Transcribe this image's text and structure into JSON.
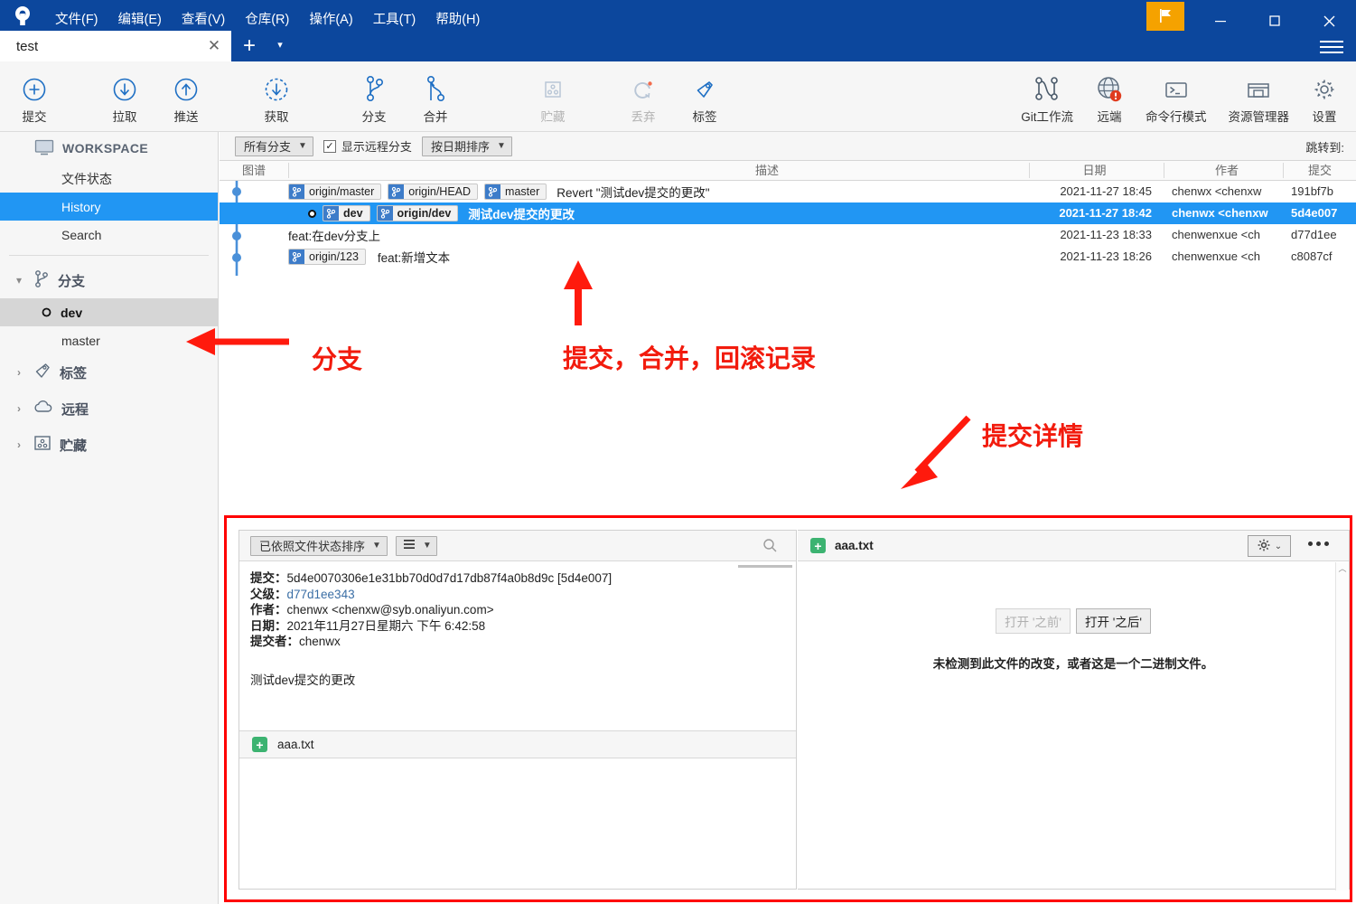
{
  "app": {
    "logo_icon": "sourcetree-logo-icon",
    "menu": [
      {
        "label": "文件(F)",
        "accel": "F"
      },
      {
        "label": "编辑(E)",
        "accel": "E"
      },
      {
        "label": "查看(V)",
        "accel": "V"
      },
      {
        "label": "仓库(R)",
        "accel": "R"
      },
      {
        "label": "操作(A)",
        "accel": "A"
      },
      {
        "label": "工具(T)",
        "accel": "T"
      },
      {
        "label": "帮助(H)",
        "accel": "H"
      }
    ],
    "window_controls": {
      "flag_icon": "flag-icon",
      "minimize": "—",
      "maximize": "☐",
      "close": "✕",
      "menu_icon": "hamburger-icon"
    }
  },
  "tabs": {
    "items": [
      {
        "label": "test",
        "close_icon": "close-icon"
      }
    ],
    "add_label": "+",
    "caret_label": "▾"
  },
  "toolbar": {
    "left_buttons": [
      {
        "label": "提交",
        "icon": "commit-plus-icon",
        "disabled": false
      },
      {
        "label": "拉取",
        "icon": "pull-down-arrow-icon",
        "disabled": false
      },
      {
        "label": "推送",
        "icon": "push-up-arrow-icon",
        "disabled": false
      },
      {
        "label": "获取",
        "icon": "fetch-dashed-arrow-icon",
        "disabled": false
      },
      {
        "label": "分支",
        "icon": "branch-icon",
        "disabled": false
      },
      {
        "label": "合并",
        "icon": "merge-icon",
        "disabled": false
      },
      {
        "label": "贮藏",
        "icon": "stash-icon",
        "disabled": true
      },
      {
        "label": "丢弃",
        "icon": "discard-revert-icon",
        "disabled": true
      },
      {
        "label": "标签",
        "icon": "tag-icon",
        "disabled": false
      }
    ],
    "right_buttons": [
      {
        "label": "Git工作流",
        "icon": "gitflow-icon",
        "badge": false
      },
      {
        "label": "远端",
        "icon": "globe-remote-icon",
        "badge": true
      },
      {
        "label": "命令行模式",
        "icon": "terminal-icon",
        "badge": false
      },
      {
        "label": "资源管理器",
        "icon": "explorer-folder-icon",
        "badge": false
      },
      {
        "label": "设置",
        "icon": "gear-icon",
        "badge": false
      }
    ]
  },
  "sidebar": {
    "workspace": {
      "label": "WORKSPACE",
      "icon": "monitor-icon"
    },
    "views": [
      {
        "label": "文件状态",
        "selected": false
      },
      {
        "label": "History",
        "selected": true
      },
      {
        "label": "Search",
        "selected": false
      }
    ],
    "groups": [
      {
        "label": "分支",
        "icon": "branch-icon",
        "expanded": true,
        "chevron": "▾",
        "items": [
          {
            "label": "dev",
            "active": true,
            "icon": "current-branch-dot-icon"
          },
          {
            "label": "master",
            "active": false,
            "icon": ""
          }
        ]
      },
      {
        "label": "标签",
        "icon": "tag-icon",
        "expanded": false,
        "chevron": "›",
        "items": []
      },
      {
        "label": "远程",
        "icon": "cloud-icon",
        "expanded": false,
        "chevron": "›",
        "items": []
      },
      {
        "label": "贮藏",
        "icon": "stash-icon",
        "expanded": false,
        "chevron": "›",
        "items": []
      }
    ]
  },
  "history": {
    "filter_branch": "所有分支",
    "show_remote_label": "显示远程分支",
    "show_remote_checked": true,
    "sort_label": "按日期排序",
    "jump_to_label": "跳转到:",
    "columns": [
      {
        "key": "graph",
        "label": "图谱"
      },
      {
        "key": "description",
        "label": "描述"
      },
      {
        "key": "date",
        "label": "日期"
      },
      {
        "key": "author",
        "label": "作者"
      },
      {
        "key": "commit",
        "label": "提交"
      }
    ],
    "rows": [
      {
        "refs": [
          {
            "name": "origin/master",
            "type": "remote"
          },
          {
            "name": "origin/HEAD",
            "type": "remote"
          },
          {
            "name": "master",
            "type": "local"
          }
        ],
        "head": false,
        "description": "Revert \"测试dev提交的更改\"",
        "date": "2021-11-27 18:45",
        "author": "chenwx <chenxw",
        "commit": "191bf7b",
        "selected": false
      },
      {
        "refs": [
          {
            "name": "dev",
            "type": "local"
          },
          {
            "name": "origin/dev",
            "type": "remote"
          }
        ],
        "head": true,
        "description": "测试dev提交的更改",
        "date": "2021-11-27 18:42",
        "author": "chenwx <chenxw",
        "commit": "5d4e007",
        "selected": true
      },
      {
        "refs": [],
        "head": false,
        "description": "feat:在dev分支上",
        "date": "2021-11-23 18:33",
        "author": "chenwenxue <ch",
        "commit": "d77d1ee",
        "selected": false
      },
      {
        "refs": [
          {
            "name": "origin/123",
            "type": "remote"
          }
        ],
        "head": false,
        "description": "feat:新增文本",
        "date": "2021-11-23 18:26",
        "author": "chenwenxue <ch",
        "commit": "c8087cf",
        "selected": false
      }
    ]
  },
  "detail": {
    "left": {
      "sort_combo": "已依照文件状态排序",
      "list_mode_icon": "list-view-icon",
      "search_icon": "search-icon",
      "meta": {
        "commit_key": "提交：",
        "commit_value": "5d4e0070306e1e31bb70d0d7d17db87f4a0b8d9c [5d4e007]",
        "parent_key": "父级：",
        "parent_value": "d77d1ee343",
        "author_key": "作者：",
        "author_value": "chenwx <chenxw@syb.onaliyun.com>",
        "date_key": "日期：",
        "date_value": "2021年11月27日星期六 下午 6:42:58",
        "committer_key": "提交者：",
        "committer_value": "chenwx"
      },
      "message": "测试dev提交的更改",
      "files": [
        {
          "name": "aaa.txt",
          "status": "added",
          "status_icon": "plus-added-icon"
        }
      ]
    },
    "right": {
      "file_name": "aaa.txt",
      "file_status_icon": "plus-added-icon",
      "gear_icon": "gear-icon",
      "gear_caret": "⌄",
      "more_icon": "ellipsis-icon",
      "open_before_label": "打开 '之前'",
      "open_after_label": "打开 '之后'",
      "no_diff_message": "未检测到此文件的改变，或者这是一个二进制文件。"
    }
  },
  "annotations": {
    "color": "#f21b0d",
    "labels": [
      {
        "id": "branch-anno",
        "text": "分支"
      },
      {
        "id": "commit-merge-rollback-anno",
        "text": "提交，合并，回滚记录"
      },
      {
        "id": "commit-detail-anno",
        "text": "提交详情"
      }
    ]
  }
}
